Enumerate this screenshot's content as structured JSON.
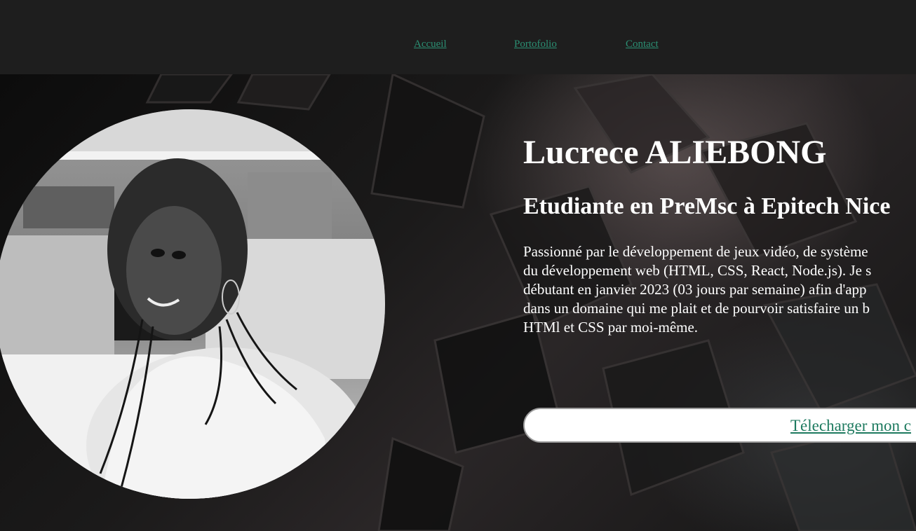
{
  "nav": {
    "items": [
      {
        "label": "Accueil"
      },
      {
        "label": "Portofolio"
      },
      {
        "label": "Contact"
      }
    ],
    "link_color": "#2b8f73"
  },
  "hero": {
    "name": "Lucrece ALIEBONG",
    "role": "Etudiante en PreMsc à Epitech Nice",
    "bio_lines": [
      "Passionné par le développement de jeux vidéo, de système",
      "du développement web (HTML, CSS, React, Node.js). Je s",
      "débutant en janvier 2023 (03 jours par semaine) afin d'app",
      "dans un domaine qui me plait et de pourvoir satisfaire un b",
      "HTMl et CSS par moi-même."
    ],
    "cv_button_label": "Télecharger mon c",
    "photo_icon": "profile-photo"
  }
}
